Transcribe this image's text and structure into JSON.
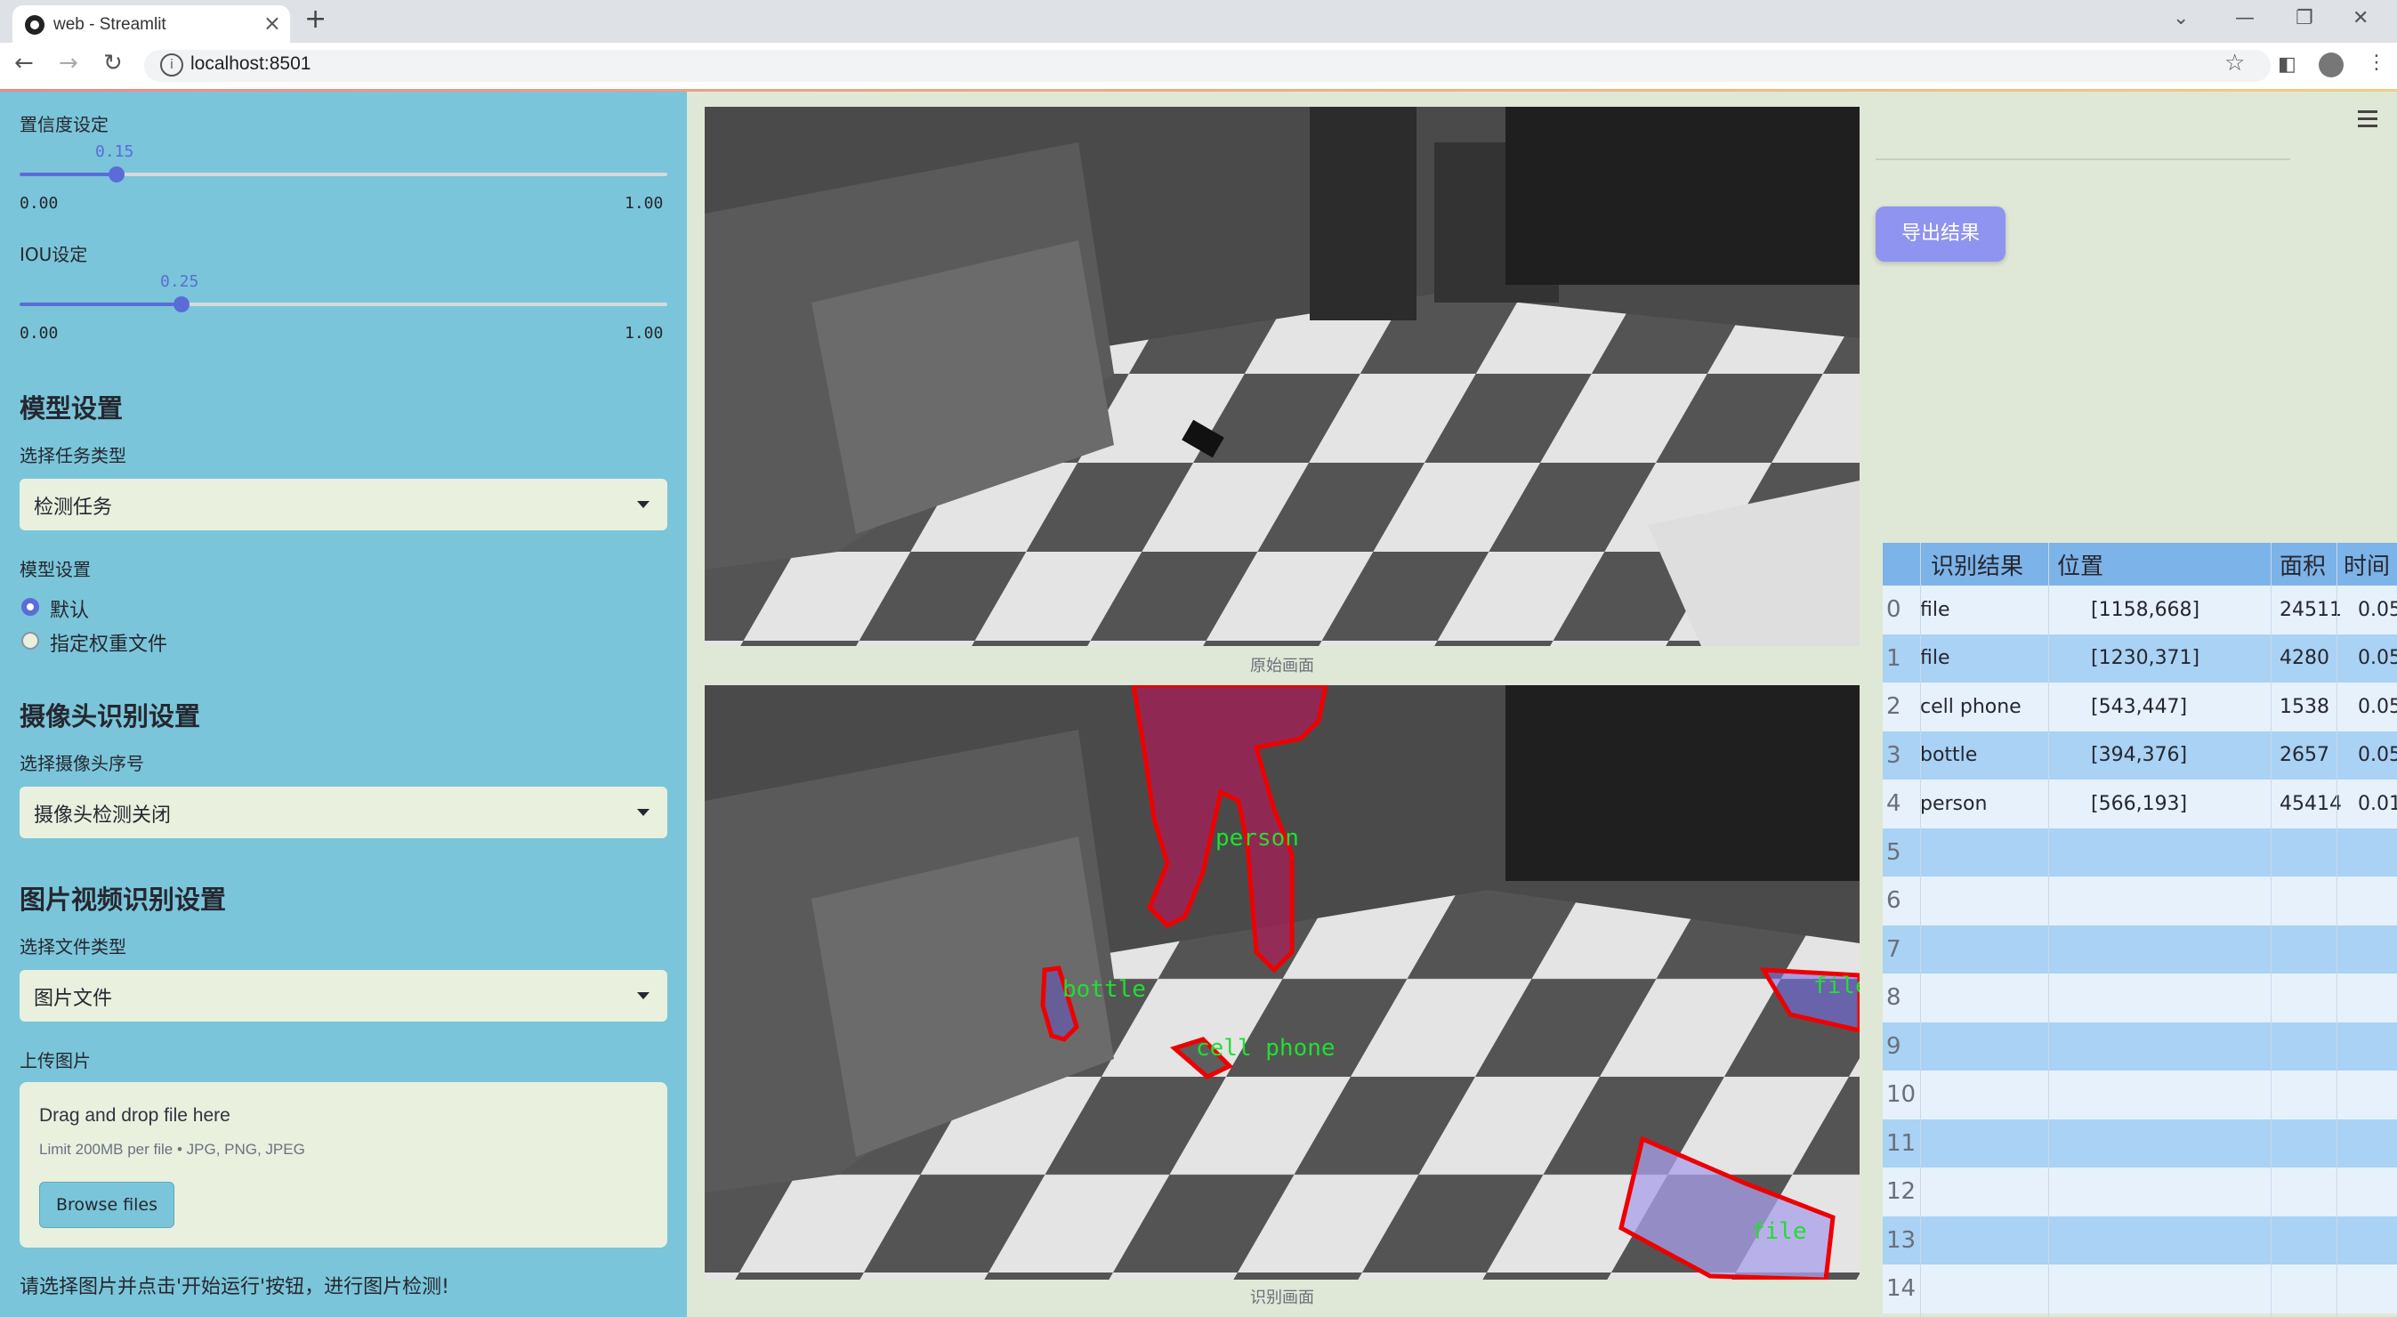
{
  "browser": {
    "tab_title": "web - Streamlit",
    "url": "localhost:8501"
  },
  "sidebar": {
    "confidence": {
      "label": "置信度设定",
      "value": "0.15",
      "fraction": 0.15,
      "min": "0.00",
      "max": "1.00"
    },
    "iou": {
      "label": "IOU设定",
      "value": "0.25",
      "fraction": 0.25,
      "min": "0.00",
      "max": "1.00"
    },
    "model_section": "模型设置",
    "task_label": "选择任务类型",
    "task_value": "检测任务",
    "model_label": "模型设置",
    "model_options": [
      "默认",
      "指定权重文件"
    ],
    "model_selected": "默认",
    "camera_section": "摄像头识别设置",
    "camera_label": "选择摄像头序号",
    "camera_value": "摄像头检测关闭",
    "file_section": "图片视频识别设置",
    "file_type_label": "选择文件类型",
    "file_type_value": "图片文件",
    "upload_label": "上传图片",
    "dropzone_title": "Drag and drop file here",
    "dropzone_limit": "Limit 200MB per file • JPG, PNG, JPEG",
    "browse_label": "Browse files",
    "hint": "请选择图片并点击'开始运行'按钮，进行图片检测!"
  },
  "main": {
    "original_caption": "原始画面",
    "result_caption": "识别画面",
    "export_label": "导出结果",
    "detections": [
      {
        "label": "person",
        "color": "#ff0000"
      },
      {
        "label": "bottle",
        "color": "#ff0000"
      },
      {
        "label": "cell phone",
        "color": "#ff0000"
      },
      {
        "label": "file",
        "color": "#ff0000"
      },
      {
        "label": "file",
        "color": "#ff0000"
      }
    ]
  },
  "table": {
    "headers": [
      "识别结果",
      "位置",
      "面积",
      "时间"
    ],
    "rows": [
      {
        "idx": "0",
        "result": "file",
        "pos": "[1158,668]",
        "area": "24511",
        "time": "0.05"
      },
      {
        "idx": "1",
        "result": "file",
        "pos": "[1230,371]",
        "area": "4280",
        "time": "0.05"
      },
      {
        "idx": "2",
        "result": "cell phone",
        "pos": "[543,447]",
        "area": "1538",
        "time": "0.05"
      },
      {
        "idx": "3",
        "result": "bottle",
        "pos": "[394,376]",
        "area": "2657",
        "time": "0.05"
      },
      {
        "idx": "4",
        "result": "person",
        "pos": "[566,193]",
        "area": "45414",
        "time": "0.01"
      },
      {
        "idx": "5",
        "result": "",
        "pos": "",
        "area": "",
        "time": ""
      },
      {
        "idx": "6",
        "result": "",
        "pos": "",
        "area": "",
        "time": ""
      },
      {
        "idx": "7",
        "result": "",
        "pos": "",
        "area": "",
        "time": ""
      },
      {
        "idx": "8",
        "result": "",
        "pos": "",
        "area": "",
        "time": ""
      },
      {
        "idx": "9",
        "result": "",
        "pos": "",
        "area": "",
        "time": ""
      },
      {
        "idx": "10",
        "result": "",
        "pos": "",
        "area": "",
        "time": ""
      },
      {
        "idx": "11",
        "result": "",
        "pos": "",
        "area": "",
        "time": ""
      },
      {
        "idx": "12",
        "result": "",
        "pos": "",
        "area": "",
        "time": ""
      },
      {
        "idx": "13",
        "result": "",
        "pos": "",
        "area": "",
        "time": ""
      },
      {
        "idx": "14",
        "result": "",
        "pos": "",
        "area": "",
        "time": ""
      }
    ]
  }
}
